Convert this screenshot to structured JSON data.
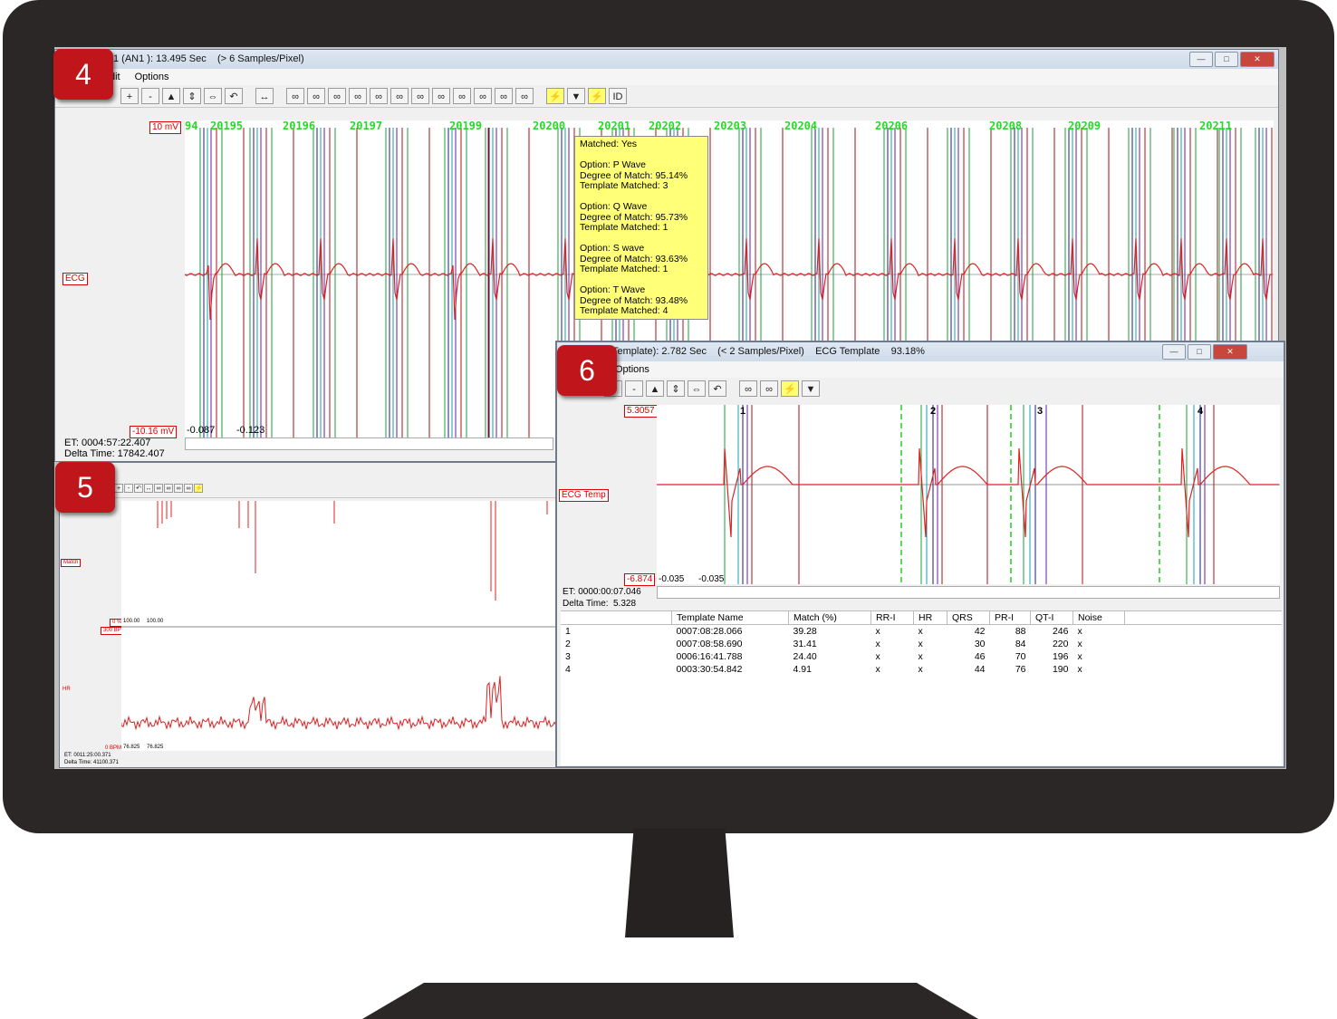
{
  "markers": [
    "4",
    "5",
    "6"
  ],
  "win4": {
    "title": "1 (AN1 ): 13.495 Sec    (> 6 Samples/Pixel)",
    "menu": [
      "dit",
      "Options"
    ],
    "scale_top": "10 mV",
    "scale_bottom": "-10.16 mV",
    "channel": "ECG",
    "beat_labels": [
      "94",
      "20195",
      "20196",
      "20197",
      "20199",
      "20200",
      "20201",
      "20202",
      "20203",
      "20204",
      "20206",
      "20208",
      "20209",
      "20211"
    ],
    "left_values": [
      "-0.087",
      "-0.123"
    ],
    "et": "ET: 0004:57:22.407",
    "delta": "Delta Time: 17842.407",
    "tooltip": {
      "matched": "Matched: Yes",
      "p": [
        "Option: P Wave",
        "Degree of Match: 95.14%",
        "Template Matched: 3"
      ],
      "q": [
        "Option: Q Wave",
        "Degree of Match: 95.73%",
        "Template Matched: 1"
      ],
      "s": [
        "Option: S wave",
        "Degree of Match: 93.63%",
        "Template Matched: 1"
      ],
      "t": [
        "Option: T Wave",
        "Degree of Match: 93.48%",
        "Template Matched: 4"
      ]
    }
  },
  "win5": {
    "ch1_top": "Match",
    "ch1_bottom": "0 %",
    "ch2_top": "300 BPM",
    "ch2_label": "HR",
    "ch2_bottom": "0 BPM",
    "vals1": [
      "100.00",
      "100.00"
    ],
    "vals2": [
      "76.825",
      "76.825"
    ],
    "et": "ET: 0011:25:00.371",
    "delta": "Delta Time: 41100.371"
  },
  "win6": {
    "title": "Template): 2.782 Sec    (< 2 Samples/Pixel)    ECG Template    93.18%",
    "menu": [
      "Options"
    ],
    "scale_top": "5.3057",
    "scale_bottom": "-6.874",
    "channel": "ECG Temp",
    "beat_nums": [
      "1",
      "2",
      "3",
      "4"
    ],
    "left_values": [
      "-0.035",
      "-0.035"
    ],
    "et": "ET: 0000:00:07.046",
    "delta_label": "Delta Time:",
    "delta_value": "5.328",
    "table": {
      "headers": [
        "Template Name",
        "Match (%)",
        "RR-I",
        "HR",
        "QRS",
        "PR-I",
        "QT-I",
        "Noise"
      ],
      "rows": [
        [
          "1",
          "0007:08:28.066",
          "39.28",
          "x",
          "x",
          "42",
          "88",
          "246",
          "x"
        ],
        [
          "2",
          "0007:08:58.690",
          "31.41",
          "x",
          "x",
          "30",
          "84",
          "220",
          "x"
        ],
        [
          "3",
          "0006:16:41.788",
          "24.40",
          "x",
          "x",
          "46",
          "70",
          "196",
          "x"
        ],
        [
          "4",
          "0003:30:54.842",
          "4.91",
          "x",
          "x",
          "44",
          "76",
          "190",
          "x"
        ]
      ]
    }
  },
  "colors": {
    "trace": "#e02020",
    "label_green": "#22dd22",
    "marker": "#c0151a"
  }
}
